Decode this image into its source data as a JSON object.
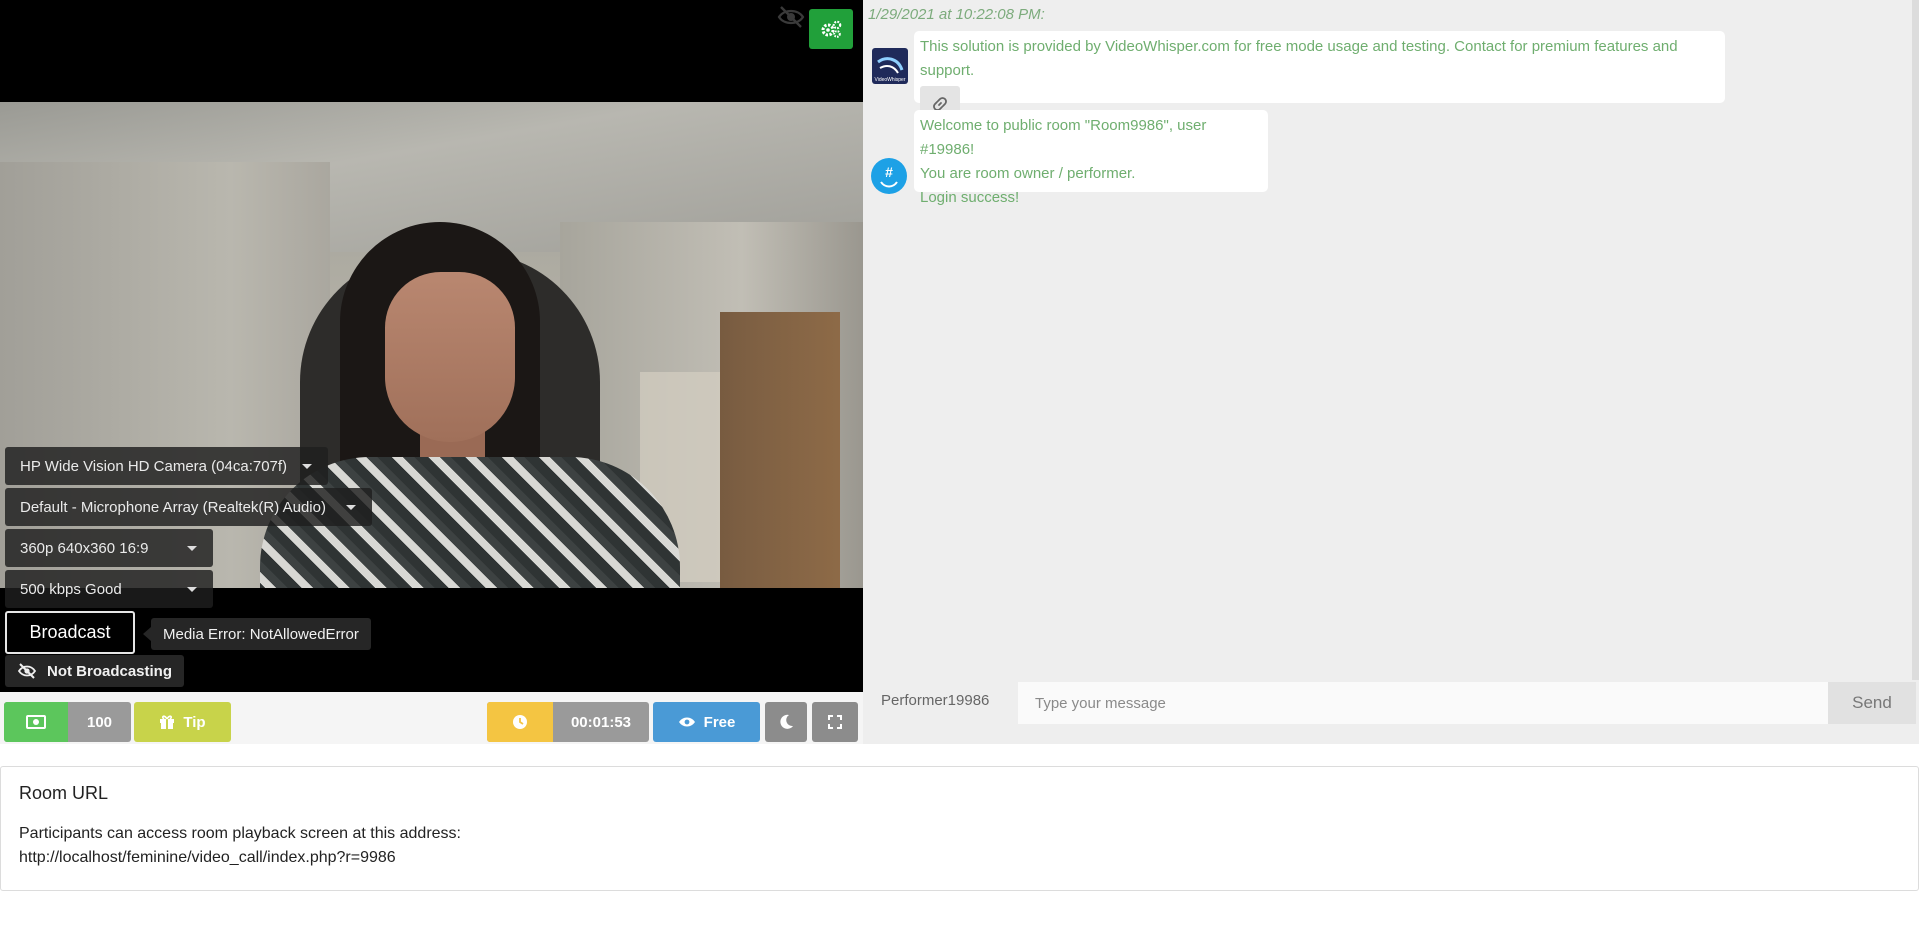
{
  "video": {
    "camera_select": "HP Wide Vision HD Camera (04ca:707f)",
    "microphone_select": "Default - Microphone Array (Realtek(R) Audio)",
    "resolution_select": "360p 640x360 16:9",
    "bitrate_select": "500 kbps Good",
    "broadcast_label": "Broadcast",
    "media_error": "Media Error: NotAllowedError",
    "status_label": "Not Broadcasting",
    "settings_icon": "cogs-icon",
    "hidden_icon": "eye-slash-icon"
  },
  "controls": {
    "balance": "100",
    "tip_label": "Tip",
    "timer": "00:01:53",
    "mode_label": "Free",
    "icons": [
      "money-icon",
      "gift-icon",
      "clock-icon",
      "eye-icon",
      "moon-icon",
      "fullscreen-icon"
    ]
  },
  "chat": {
    "timestamp": "1/29/2021 at 10:22:08 PM:",
    "messages": [
      {
        "lines": [
          "This solution is provided by VideoWhisper.com for free mode usage and testing. Contact for premium features and support."
        ],
        "avatar": "videowhisper-logo",
        "link_icon": "link-icon"
      },
      {
        "lines": [
          "Welcome to public room \"Room9986\", user #19986!",
          "You are room owner / performer.",
          "Login success!"
        ],
        "avatar": "hashtag-avatar"
      }
    ],
    "username": "Performer19986",
    "input_placeholder": "Type your message",
    "send_label": "Send"
  },
  "room_url": {
    "title": "Room URL",
    "description": "Participants can access room playback screen at this address:",
    "url": "http://localhost/feminine/video_call/index.php?r=9986"
  },
  "colors": {
    "green": "#21a03a",
    "balance_green": "#5cc65c",
    "tip_yellow": "#c8d34a",
    "timer_yellow": "#f4c542",
    "free_blue": "#4a9ad6",
    "chat_text": "#6fae6f"
  }
}
